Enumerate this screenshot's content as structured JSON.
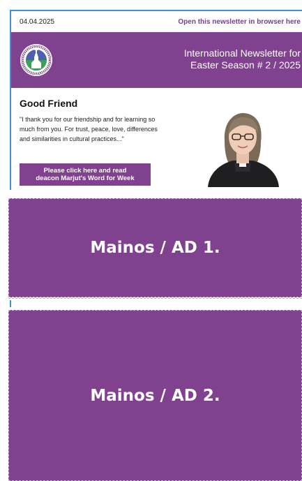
{
  "topbar": {
    "date": "04.04.2025",
    "browser_link": "Open this newsletter in browser here"
  },
  "header": {
    "title_line1": "International Newsletter for",
    "title_line2": "Easter Season # 2 / 2025",
    "logo_icon": "parish-logo-icon"
  },
  "article": {
    "heading": "Good Friend",
    "quote": "\"I thank you for our friendship and for learning so much from you. For trust, peace, love, differences and similarities in cultural practices...\"",
    "cta_line1": "Please click here and read",
    "cta_line2": "deacon Marjut's Word for Week"
  },
  "ads": {
    "ad1": "Mainos / AD 1.",
    "ad2": "Mainos / AD 2."
  },
  "colors": {
    "brand_purple": "#80418f",
    "frame_blue": "#3d8fd6"
  }
}
